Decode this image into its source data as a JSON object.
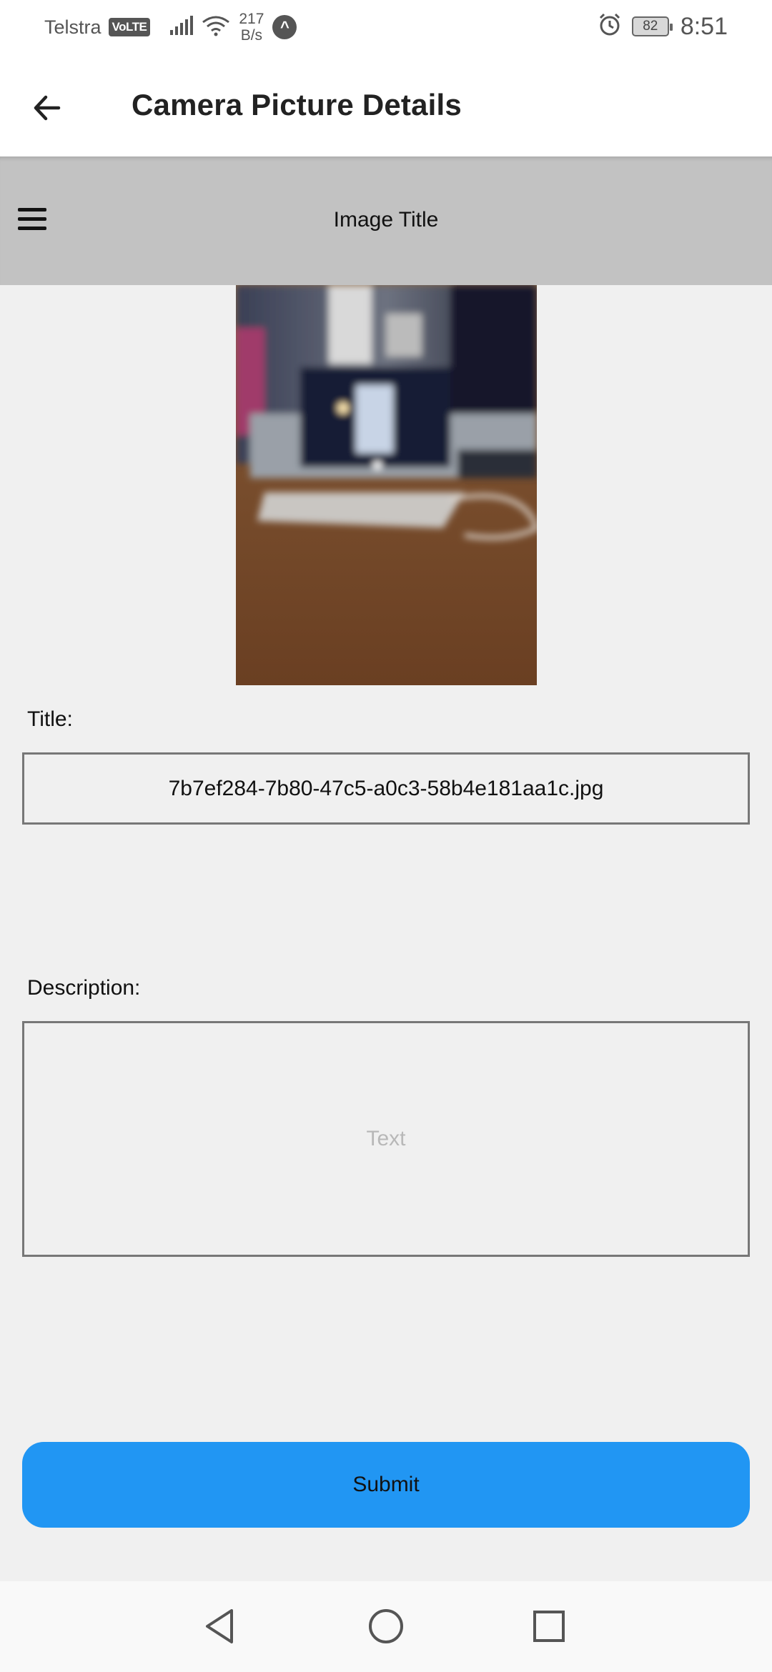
{
  "status_bar": {
    "carrier": "Telstra",
    "volte": "VoLTE",
    "net_speed_value": "217",
    "net_speed_unit": "B/s",
    "vpn_glyph": "^",
    "battery": "82",
    "time": "8:51"
  },
  "app_bar": {
    "title": "Camera Picture Details",
    "back_icon": "arrow-left-icon"
  },
  "sub_header": {
    "title": "Image Title",
    "menu_icon": "hamburger-menu-icon"
  },
  "form": {
    "title_label": "Title:",
    "title_value": "7b7ef284-7b80-47c5-a0c3-58b4e181aa1c.jpg",
    "description_label": "Description:",
    "description_placeholder": "Text",
    "submit_label": "Submit"
  },
  "colors": {
    "accent": "#2196f3",
    "sub_header_bg": "#c2c2c2",
    "page_bg": "#f0f0f0"
  },
  "nav_bar": {
    "icons": [
      "triangle-back-icon",
      "circle-home-icon",
      "square-recents-icon"
    ]
  }
}
